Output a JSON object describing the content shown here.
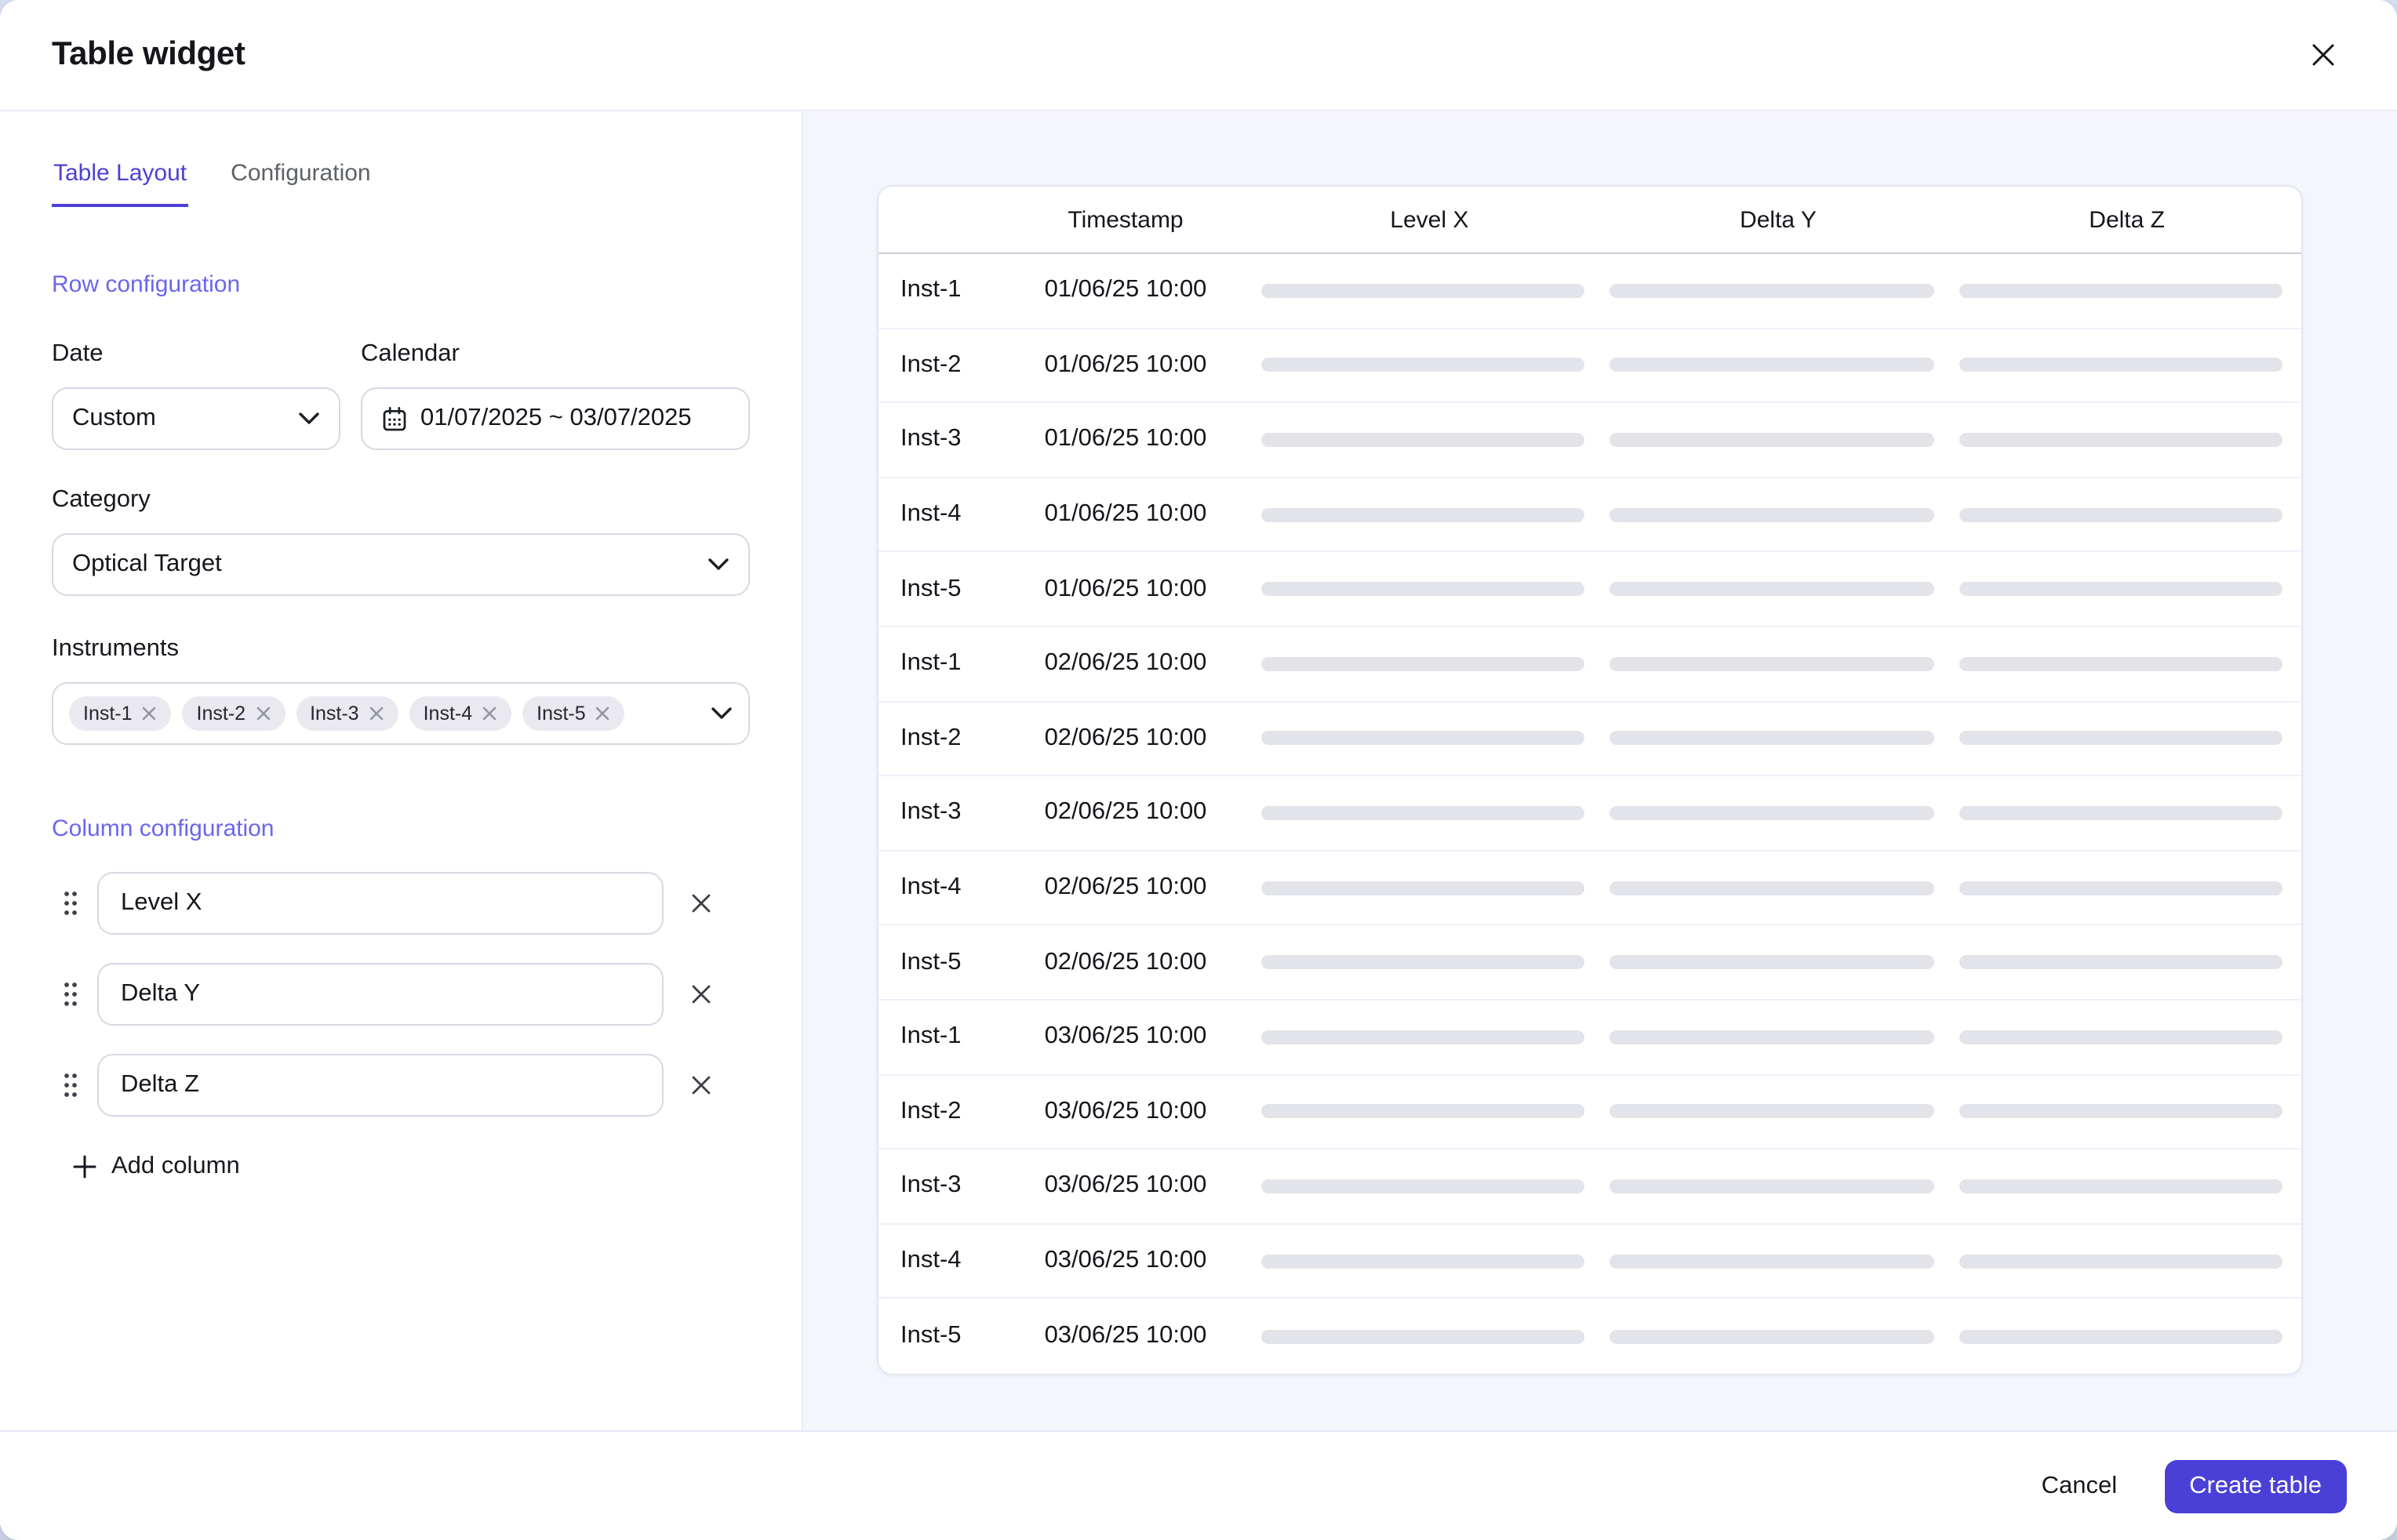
{
  "dialog": {
    "title": "Table widget"
  },
  "tabs": [
    {
      "label": "Table Layout",
      "active": true
    },
    {
      "label": "Configuration",
      "active": false
    }
  ],
  "row_config": {
    "section_label": "Row configuration",
    "date": {
      "label": "Date",
      "value": "Custom"
    },
    "calendar": {
      "label": "Calendar",
      "value": "01/07/2025 ~ 03/07/2025"
    },
    "category": {
      "label": "Category",
      "value": "Optical Target"
    },
    "instruments": {
      "label": "Instruments",
      "chips": [
        "Inst-1",
        "Inst-2",
        "Inst-3",
        "Inst-4",
        "Inst-5"
      ]
    }
  },
  "column_config": {
    "section_label": "Column configuration",
    "columns": [
      "Level X",
      "Delta Y",
      "Delta Z"
    ],
    "add_label": "Add column"
  },
  "preview": {
    "headers": [
      "Timestamp",
      "Level X",
      "Delta Y",
      "Delta Z"
    ],
    "rows": [
      {
        "instrument": "Inst-1",
        "timestamp": "01/06/25 10:00"
      },
      {
        "instrument": "Inst-2",
        "timestamp": "01/06/25 10:00"
      },
      {
        "instrument": "Inst-3",
        "timestamp": "01/06/25 10:00"
      },
      {
        "instrument": "Inst-4",
        "timestamp": "01/06/25 10:00"
      },
      {
        "instrument": "Inst-5",
        "timestamp": "01/06/25 10:00"
      },
      {
        "instrument": "Inst-1",
        "timestamp": "02/06/25 10:00"
      },
      {
        "instrument": "Inst-2",
        "timestamp": "02/06/25 10:00"
      },
      {
        "instrument": "Inst-3",
        "timestamp": "02/06/25 10:00"
      },
      {
        "instrument": "Inst-4",
        "timestamp": "02/06/25 10:00"
      },
      {
        "instrument": "Inst-5",
        "timestamp": "02/06/25 10:00"
      },
      {
        "instrument": "Inst-1",
        "timestamp": "03/06/25 10:00"
      },
      {
        "instrument": "Inst-2",
        "timestamp": "03/06/25 10:00"
      },
      {
        "instrument": "Inst-3",
        "timestamp": "03/06/25 10:00"
      },
      {
        "instrument": "Inst-4",
        "timestamp": "03/06/25 10:00"
      },
      {
        "instrument": "Inst-5",
        "timestamp": "03/06/25 10:00"
      }
    ]
  },
  "footer": {
    "cancel_label": "Cancel",
    "create_label": "Create table"
  },
  "colors": {
    "accent": "#4a3fd6",
    "active_tab": "#4c3fd6",
    "section_label": "#6b66ee",
    "preview_background": "#f5f6fc",
    "placeholder_bar": "#e3e4ea",
    "chip_background": "#e9e9ef",
    "input_border": "#d6d9e2",
    "divider": "#e9ecf5"
  }
}
